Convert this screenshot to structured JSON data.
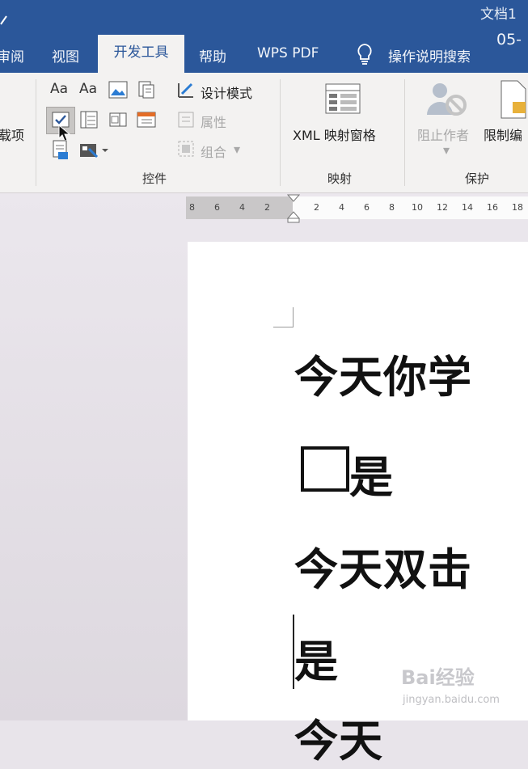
{
  "window": {
    "doc_title": "文档1",
    "date_fragment": "05-"
  },
  "tabs": {
    "review_partial": "审阅",
    "view": "视图",
    "developer": "开发工具",
    "help": "帮助",
    "wps_pdf": "WPS PDF",
    "tell_me": "操作说明搜索"
  },
  "ribbon": {
    "left_partial": "载项",
    "controls": {
      "design_mode": "设计模式",
      "properties": "属性",
      "group": "组合",
      "label": "控件"
    },
    "mapping": {
      "xml_pane": "XML 映射窗格",
      "label": "映射"
    },
    "protect": {
      "block_authors": "阻止作者",
      "restrict_partial": "限制编",
      "label": "保护"
    }
  },
  "ruler": {
    "left_ticks": [
      "8",
      "6",
      "4",
      "2"
    ],
    "right_ticks": [
      "2",
      "4",
      "6",
      "8",
      "10",
      "12",
      "14",
      "16",
      "18"
    ]
  },
  "document": {
    "line1": "今天你学",
    "line2": "是",
    "line3": "今天双击",
    "line4": "是",
    "line5": "今天"
  },
  "watermark": {
    "brand": "Bai经验",
    "url": "jingyan.baidu.com"
  },
  "colors": {
    "title_bar": "#2b579a",
    "ribbon_bg": "#f3f2f1",
    "page_bg": "#ffffff"
  }
}
